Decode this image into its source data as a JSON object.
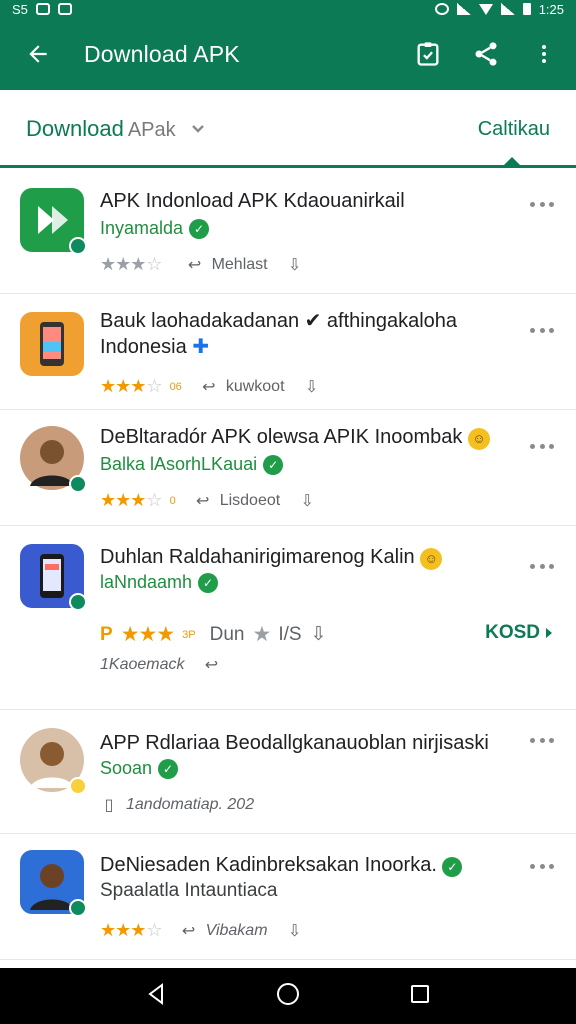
{
  "status_bar": {
    "left_text": "S5",
    "right_text": "1:25"
  },
  "app_bar": {
    "title": "Download APK"
  },
  "sub_header": {
    "filter_main": "Download",
    "filter_rest": "APak",
    "right_label": "Caltikau"
  },
  "apps": [
    {
      "title": "APK Indonload APK Kdaouanirkail",
      "subtitle": "Inyamalda",
      "rating": 3.5,
      "stars_text": "",
      "meta_text": "Mehlast",
      "icon_color": "#1f9d48"
    },
    {
      "title": "Bauk laohadakadanan ✔ afthingakaloha Indonesia",
      "subtitle": "",
      "rating": 3.5,
      "stars_text": "06",
      "meta_text": "kuwkoot",
      "icon_color": "#f0a030"
    },
    {
      "title": "DeBltaradór APK olewsa APIK Inoombak",
      "subtitle": "Balka lAsorhLKauai",
      "rating": 3.5,
      "stars_text": "0",
      "meta_text": "Lisdoeot",
      "icon_color": "#c89b7b"
    },
    {
      "title": "Duhlan Raldahanirigimarenog Kalin",
      "subtitle": "laNndaamh",
      "rating": 3,
      "stars_text": "3P",
      "meta_text": "Dun",
      "meta_extra": "I/S",
      "sub_meta": "1Kaoemack",
      "action_label": "KOSD",
      "icon_color": "#3a5bd0"
    },
    {
      "title": "APP Rdlariaa Beodallgkanauoblan nirjisaski",
      "subtitle": "Sooan",
      "rating": 0,
      "stars_text": "",
      "meta_text": "1andomatiap. 202",
      "icon_color": "#d8c0a8"
    },
    {
      "title": "DeNiesaden Kadinbreksakan Inoorka.",
      "subtitle": "Spaalatla Intauntiaca",
      "rating": 3.5,
      "stars_text": "",
      "meta_text": "Vibakam",
      "icon_color": "#2d6fd6"
    }
  ]
}
